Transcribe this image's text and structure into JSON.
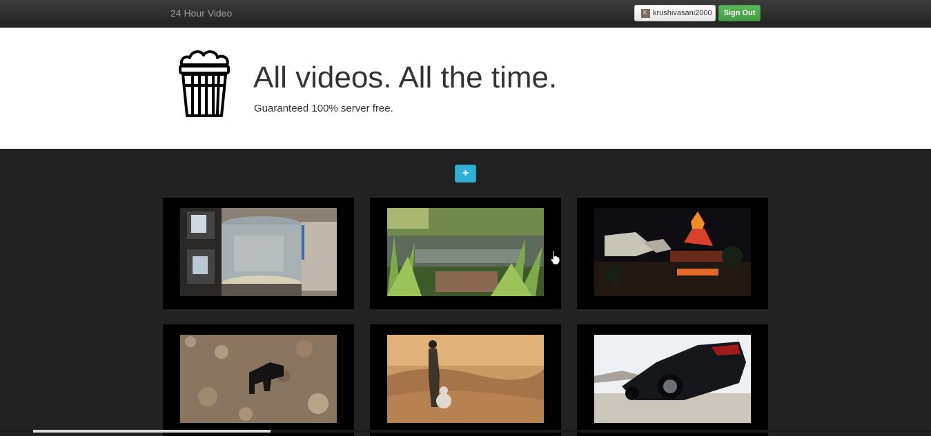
{
  "navbar": {
    "brand": "24 Hour Video",
    "username": "krushivasani2000",
    "sign_out_label": "Sign Out"
  },
  "hero": {
    "headline": "All videos. All the time.",
    "tagline": "Guaranteed 100% server free.",
    "logo_icon": "popcorn-bucket-icon"
  },
  "actions": {
    "add_icon": "plus-icon",
    "add_symbol": "+"
  },
  "videos": [
    {
      "subject": "water-tank"
    },
    {
      "subject": "forest-stream"
    },
    {
      "subject": "volcano-night"
    },
    {
      "subject": "dog-rocks"
    },
    {
      "subject": "desert-droid"
    },
    {
      "subject": "sports-car"
    }
  ],
  "colors": {
    "navbar": "#2b2b2b",
    "hero_bg": "#ffffff",
    "page_bg": "#222222",
    "sign_out": "#5cb85c",
    "add_button": "#31b0d5"
  }
}
